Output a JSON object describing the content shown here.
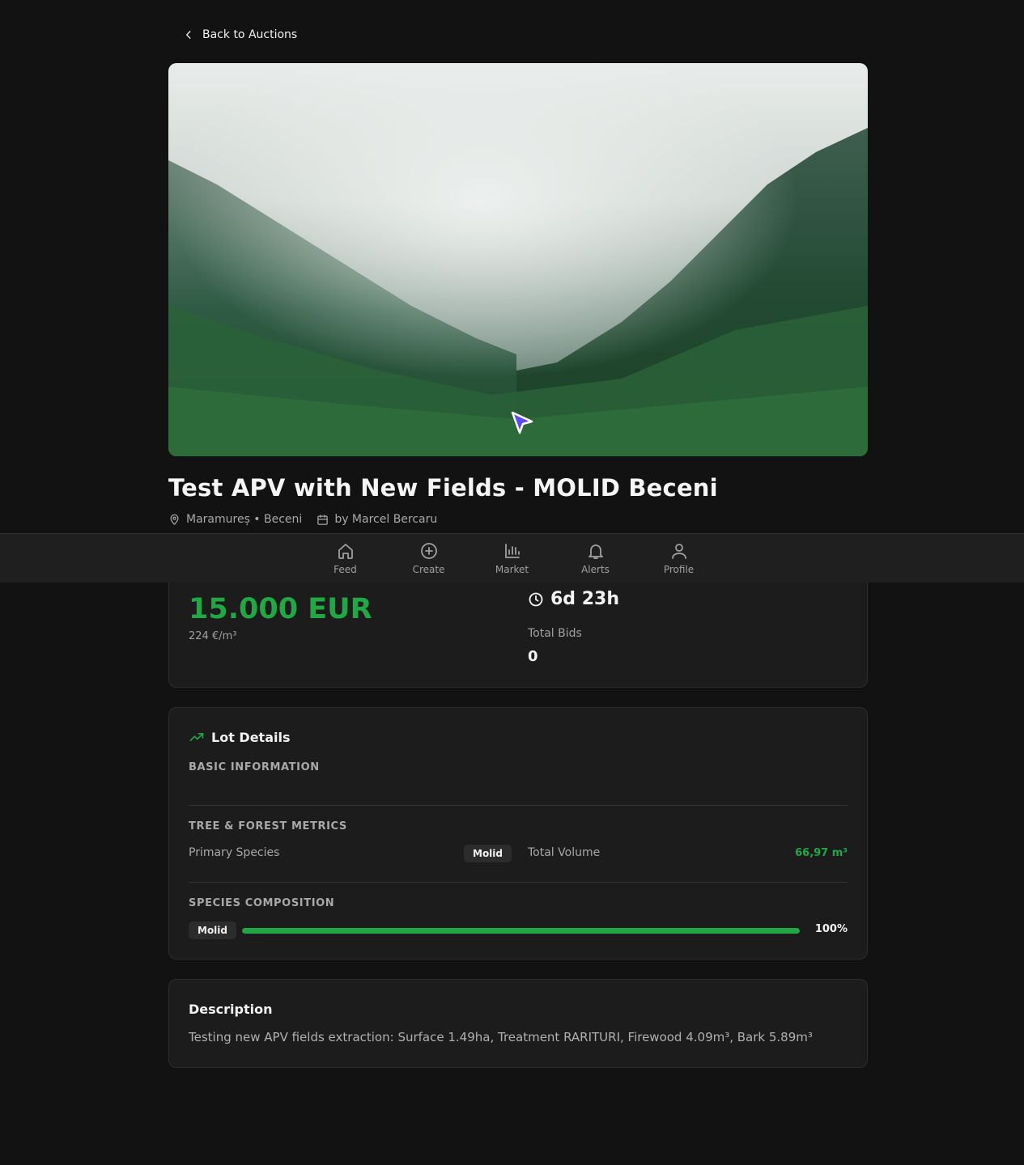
{
  "nav": {
    "back_label": "Back to Auctions"
  },
  "listing": {
    "title": "Test APV with New Fields - MOLID Beceni",
    "location": "Maramureș • Beceni",
    "author": "by Marcel Bercaru"
  },
  "bottom_nav": {
    "items": [
      {
        "label": "Feed",
        "icon": "home-icon"
      },
      {
        "label": "Create",
        "icon": "plus-circle-icon"
      },
      {
        "label": "Market",
        "icon": "bar-chart-icon"
      },
      {
        "label": "Alerts",
        "icon": "bell-icon"
      },
      {
        "label": "Profile",
        "icon": "user-icon"
      }
    ]
  },
  "pricing": {
    "price": "15.000 EUR",
    "unit_price": "224 €/m³",
    "time_left": "6d 23h",
    "total_bids_label": "Total Bids",
    "total_bids": "0"
  },
  "lot_details": {
    "title": "Lot Details",
    "basic_info_title": "BASIC INFORMATION",
    "metrics_title": "TREE & FOREST METRICS",
    "primary_species_label": "Primary Species",
    "primary_species": "Molid",
    "total_volume_label": "Total Volume",
    "total_volume": "66,97 m³",
    "composition_title": "SPECIES COMPOSITION",
    "composition": [
      {
        "species": "Molid",
        "percent_label": "100%",
        "fraction": 1.0
      }
    ]
  },
  "description": {
    "title": "Description",
    "text": "Testing new APV fields extraction: Surface 1.49ha, Treatment RARITURI, Firewood 4.09m³, Bark 5.89m³"
  },
  "colors": {
    "accent": "#22a745",
    "background": "#121212",
    "card": "#1c1c1c"
  }
}
